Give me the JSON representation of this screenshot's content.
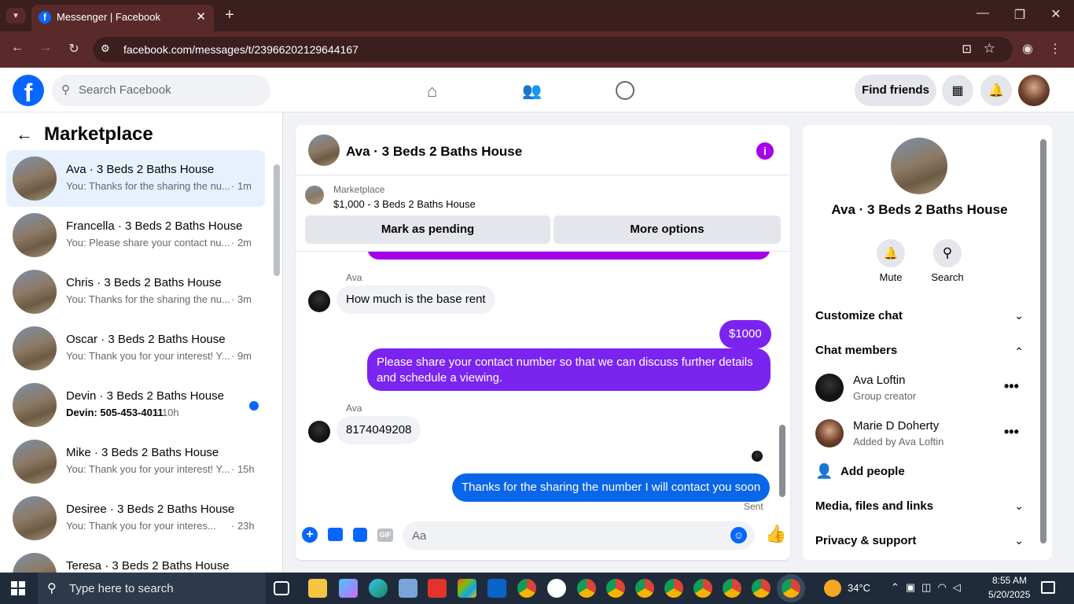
{
  "browser": {
    "tab_title": "Messenger | Facebook",
    "url": "facebook.com/messages/t/23966202129644167"
  },
  "header": {
    "search_placeholder": "Search Facebook",
    "find_friends": "Find friends"
  },
  "sidebar": {
    "title": "Marketplace",
    "conversations": [
      {
        "name": "Ava · 3 Beds 2 Baths House",
        "preview": "You: Thanks for the sharing the nu...",
        "time": "· 1m",
        "selected": true
      },
      {
        "name": "Francella · 3 Beds 2 Baths House",
        "preview": "You: Please share your contact nu...",
        "time": "· 2m"
      },
      {
        "name": "Chris · 3 Beds 2 Baths House",
        "preview": "You: Thanks for the sharing the nu...",
        "time": "· 3m"
      },
      {
        "name": "Oscar · 3 Beds 2 Baths House",
        "preview": "You: Thank you for your interest! Y...",
        "time": "· 9m"
      },
      {
        "name": "Devin · 3 Beds 2 Baths House",
        "preview": "Devin: 505-453-4011",
        "time": "· 10h",
        "unread": true
      },
      {
        "name": "Mike · 3 Beds 2 Baths House",
        "preview": "You: Thank you for your interest! Y...",
        "time": "· 15h"
      },
      {
        "name": "Desiree · 3 Beds 2 Baths House",
        "preview": "You: Thank you for your interes...",
        "time": "· 23h"
      },
      {
        "name": "Teresa · 3 Beds 2 Baths House",
        "preview": "",
        "time": ""
      }
    ]
  },
  "chat": {
    "title": "Ava · 3 Beds 2 Baths House",
    "listing_label": "Marketplace",
    "listing_detail": "$1,000 - 3 Beds 2 Baths House",
    "mark_pending": "Mark as pending",
    "more_options": "More options",
    "messages": {
      "sender1": "Ava",
      "msg1": "How much is the base rent",
      "msg2": "$1000",
      "msg3": "Please share your contact number so that we can discuss further details and schedule a viewing.",
      "sender2": "Ava",
      "msg4": "8174049208",
      "msg5": "Thanks for the sharing the number I will contact you soon",
      "status": "Sent"
    },
    "composer_placeholder": "Aa",
    "gif_label": "GIF"
  },
  "details": {
    "title": "Ava · 3 Beds 2 Baths House",
    "mute": "Mute",
    "search": "Search",
    "customize": "Customize chat",
    "members_heading": "Chat members",
    "members": [
      {
        "name": "Ava Loftin",
        "role": "Group creator"
      },
      {
        "name": "Marie D Doherty",
        "role": "Added by Ava Loftin"
      }
    ],
    "add_people": "Add people",
    "media": "Media, files and links",
    "privacy": "Privacy & support"
  },
  "taskbar": {
    "search_placeholder": "Type here to search",
    "weather": "34°C",
    "time": "8:55 AM",
    "date": "5/20/2025"
  },
  "colors": {
    "fb_blue": "#0866ff",
    "purple_bubble": "#7b24f0",
    "blue_bubble": "#0a66e8"
  }
}
